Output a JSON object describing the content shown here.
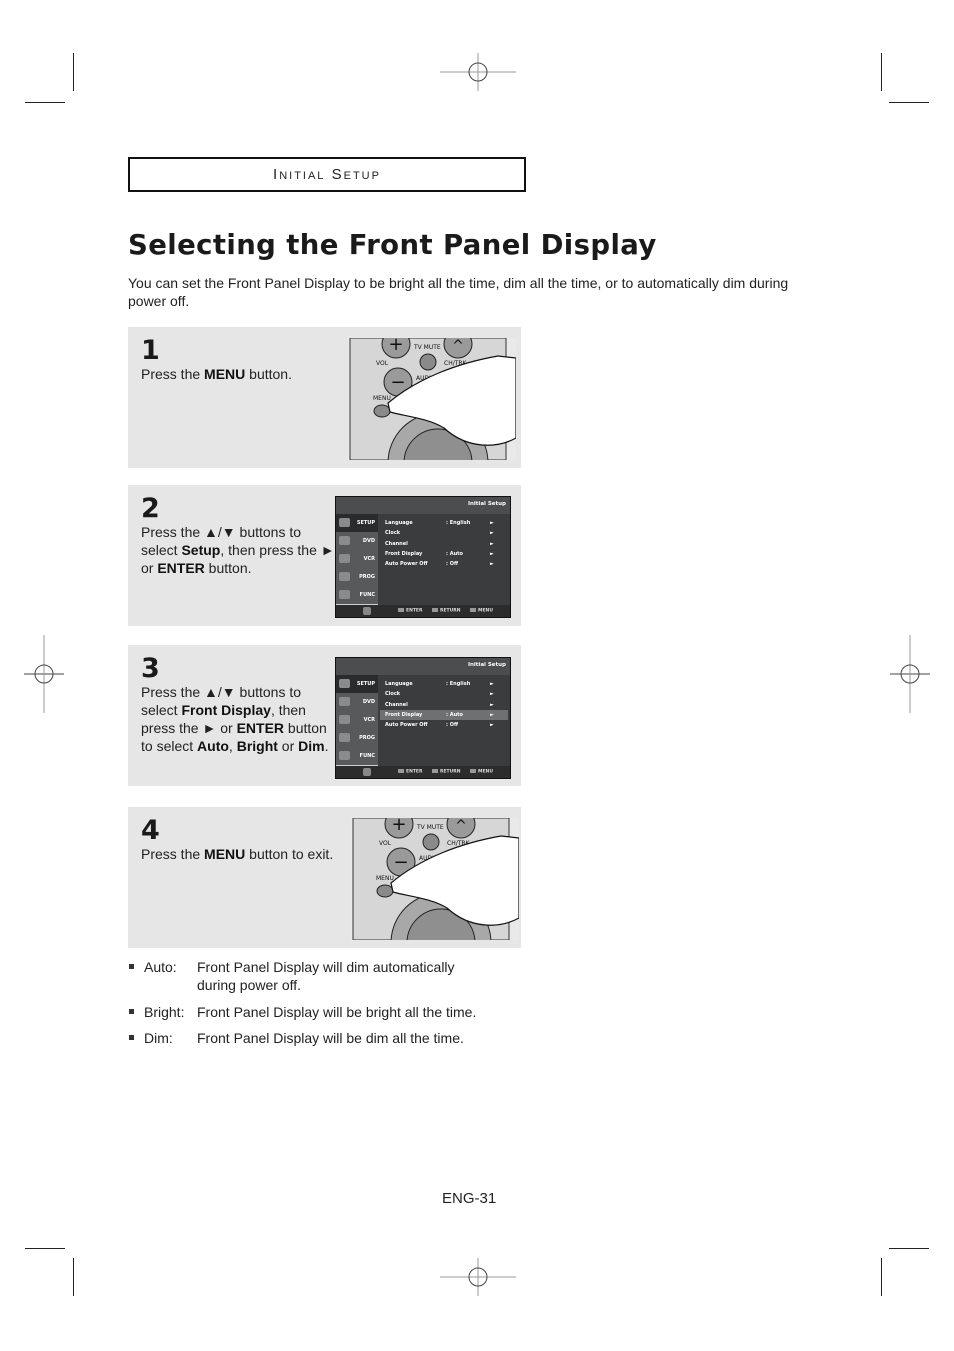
{
  "section_header": "Initial Setup",
  "title": "Selecting the Front Panel Display",
  "intro": "You can set the Front Panel Display to be bright all the time, dim all the time, or to automatically dim during power off.",
  "steps": [
    {
      "number": "1",
      "parts": [
        "Press the ",
        "MENU",
        " button."
      ],
      "figure": "remote-menu-button-press"
    },
    {
      "number": "2",
      "lines": [
        [
          "Press the ",
          "▲/▼",
          " buttons to"
        ],
        [
          "select ",
          "Setup",
          ", then press the ►"
        ],
        [
          "or ",
          "ENTER",
          " button."
        ]
      ],
      "figure": "osd-initial-setup"
    },
    {
      "number": "3",
      "lines": [
        [
          "Press the ",
          "▲/▼",
          " buttons to"
        ],
        [
          "select ",
          "Front Display",
          ", then"
        ],
        [
          "press the ► or ",
          "ENTER",
          " button"
        ],
        [
          "to select ",
          "Auto",
          ", ",
          "Bright",
          " or ",
          "Dim",
          "."
        ]
      ],
      "figure": "osd-initial-setup-front-display-highlighted"
    },
    {
      "number": "4",
      "parts": [
        "Press the ",
        "MENU",
        " button to exit."
      ],
      "figure": "remote-menu-button-press"
    }
  ],
  "remote_labels": {
    "tv_mute": "TV MUTE",
    "vol": "VOL",
    "ch_trk": "CH/TRK",
    "audio": "AUDIO",
    "menu": "MENU"
  },
  "osd": {
    "title": "Initial Setup",
    "sidebar": [
      "SETUP",
      "DVD",
      "VCR",
      "PROG",
      "FUNC"
    ],
    "rows": [
      {
        "name": "Language",
        "value": ": English",
        "arrow": "►"
      },
      {
        "name": "Clock",
        "value": "",
        "arrow": "►"
      },
      {
        "name": "Channel",
        "value": "",
        "arrow": "►"
      },
      {
        "name": "Front Display",
        "value": ": Auto",
        "arrow": "►"
      },
      {
        "name": "Auto Power Off",
        "value": ": Off",
        "arrow": "►"
      }
    ],
    "hints": [
      "ENTER",
      "RETURN",
      "MENU"
    ]
  },
  "bullets": [
    {
      "key": "Auto:",
      "desc": "Front Panel Display will dim automatically during power off."
    },
    {
      "key": "Bright:",
      "desc": "Front Panel Display will be bright all the time."
    },
    {
      "key": "Dim:",
      "desc": "Front Panel Display will be dim all the time."
    }
  ],
  "page_number": "ENG-31"
}
